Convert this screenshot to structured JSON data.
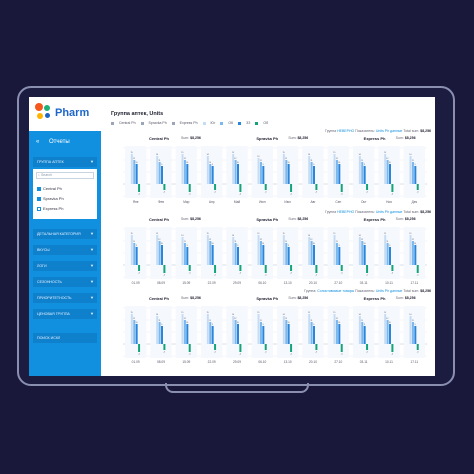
{
  "app": {
    "logo_text": "Pharm",
    "logo_colors": [
      "#f4581e",
      "#1fb07a",
      "#ffb400",
      "#1c66c8"
    ]
  },
  "sidebar": {
    "reports_label": "Отчеты",
    "pharmacy_group_label": "ГРУППА АПТЕК",
    "search_placeholder": "Search",
    "options": [
      {
        "label": "Central Ph",
        "checked": true
      },
      {
        "label": "Spravka Ph",
        "checked": true
      },
      {
        "label": "Express Ph",
        "checked": false
      }
    ],
    "items": [
      {
        "label": "ДЕТАЛЬНАЯ КАТЕГОРИЯ"
      },
      {
        "label": "ВКУСЫ"
      },
      {
        "label": "ЛОГИ"
      },
      {
        "label": "СЕЗОННОСТЬ"
      },
      {
        "label": "ПРИОРИТЕТНОСТЬ"
      },
      {
        "label": "ЦЕНОВАЯ ГРУППА"
      },
      {
        "label": "ПОИСК ИСКЛ"
      }
    ]
  },
  "main": {
    "title": "Группа аптек, Units",
    "legend": [
      {
        "label": "Central Ph",
        "color": "#9aa6b8"
      },
      {
        "label": "Spravka Ph",
        "color": "#9aa6b8"
      },
      {
        "label": "Express Ph",
        "color": "#9aa6b8"
      },
      {
        "label": "Юг",
        "color": "#c6dcf5"
      },
      {
        "label": "ОК",
        "color": "#7ab8ee"
      },
      {
        "label": "ЗЗ",
        "color": "#2a86dc"
      },
      {
        "label": "Об",
        "color": "#14a37a"
      }
    ],
    "panels": [
      {
        "top_line": {
          "group_label": "Группа",
          "group_value": "НЕВЕРНО",
          "pokaz_label": "Показатель:",
          "pokaz_value": "Units Ph данные",
          "total_label": "Total sum:",
          "total_value": "$8,256"
        },
        "groups": [
          {
            "name": "Central Ph",
            "sum_label": "Sum:",
            "sum_value": "$8,256"
          },
          {
            "name": "Spravka Ph",
            "sum_label": "Sum:",
            "sum_value": "$8,256"
          },
          {
            "name": "Express Ph",
            "sum_label": "Sum:",
            "sum_value": "$8,256"
          }
        ],
        "x_labels": [
          "Яне",
          "Фев",
          "Мар",
          "Апр",
          "Май",
          "Июн",
          "Июл",
          "Авг",
          "Сен",
          "Окт",
          "Ноя",
          "Дек"
        ]
      },
      {
        "top_line": {
          "group_label": "Группа",
          "group_value": "НЕВЕРНО",
          "pokaz_label": "Показатель:",
          "pokaz_value": "Units Ph данные",
          "total_label": "Total sum:",
          "total_value": "$8,256"
        },
        "groups": [
          {
            "name": "Central Ph",
            "sum_label": "Sum:",
            "sum_value": "$8,256"
          },
          {
            "name": "Spravka Ph",
            "sum_label": "Sum:",
            "sum_value": "$8,256"
          },
          {
            "name": "Express Ph",
            "sum_label": "Sum:",
            "sum_value": "$8,256"
          }
        ],
        "x_labels": [
          "01.09",
          "08.09",
          "15.09",
          "22.09",
          "29.09",
          "06.10",
          "13.10",
          "20.10",
          "27.10",
          "03.11",
          "10.11",
          "17.11"
        ]
      },
      {
        "top_line": {
          "group_label": "Группа:",
          "group_value": "Сопоставимые товары",
          "pokaz_label": "Показатель:",
          "pokaz_value": "Units Ph данные",
          "total_label": "Total sum:",
          "total_value": "$8,256"
        },
        "groups": [
          {
            "name": "Central Ph",
            "sum_label": "Sum:",
            "sum_value": "$8,256"
          },
          {
            "name": "Spravka Ph",
            "sum_label": "Sum:",
            "sum_value": "$8,256"
          },
          {
            "name": "Express Ph",
            "sum_label": "Sum:",
            "sum_value": "$8,256"
          }
        ],
        "x_labels": [
          "01.09",
          "08.09",
          "15.09",
          "22.09",
          "29.09",
          "06.10",
          "13.10",
          "20.10",
          "27.10",
          "03.11",
          "10.11",
          "17.11"
        ]
      }
    ]
  },
  "chart_data": [
    {
      "type": "bar",
      "title": "",
      "categories": [
        "Яне",
        "Фев",
        "Мар",
        "Апр",
        "Май",
        "Июн",
        "Июл",
        "Авг",
        "Сен",
        "Окт",
        "Ноя",
        "Дек"
      ],
      "series": [
        {
          "name": "Юг",
          "color": "#c6dcf5",
          "values": [
            15,
            14,
            15,
            14,
            15,
            13,
            15,
            14,
            15,
            14,
            15,
            14
          ]
        },
        {
          "name": "ОК",
          "color": "#7ab8ee",
          "values": [
            12,
            11,
            12,
            10,
            12,
            11,
            12,
            11,
            12,
            11,
            12,
            11
          ]
        },
        {
          "name": "ЗЗ",
          "color": "#2a86dc",
          "values": [
            10,
            9,
            10,
            9,
            10,
            9,
            10,
            9,
            10,
            9,
            10,
            9
          ]
        },
        {
          "name": "Об",
          "color": "#14a37a",
          "values": [
            -4,
            -3,
            -4,
            -3,
            -4,
            -3,
            -4,
            -3,
            -4,
            -3,
            -4,
            -3
          ]
        }
      ],
      "ylim": [
        -6,
        18
      ]
    },
    {
      "type": "bar",
      "title": "",
      "categories": [
        "01.09",
        "08.09",
        "15.09",
        "22.09",
        "29.09",
        "06.10",
        "13.10",
        "20.10",
        "27.10",
        "03.11",
        "10.11",
        "17.11"
      ],
      "series": [
        {
          "name": "Юг",
          "color": "#c6dcf5",
          "values": [
            15,
            15,
            14,
            15,
            14,
            15,
            15,
            14,
            15,
            14,
            15,
            15
          ]
        },
        {
          "name": "ОК",
          "color": "#7ab8ee",
          "values": [
            11,
            12,
            11,
            12,
            11,
            12,
            11,
            12,
            11,
            12,
            11,
            12
          ]
        },
        {
          "name": "ЗЗ",
          "color": "#2a86dc",
          "values": [
            9,
            10,
            9,
            10,
            9,
            10,
            9,
            10,
            9,
            10,
            9,
            10
          ]
        },
        {
          "name": "Об",
          "color": "#14a37a",
          "values": [
            -3,
            -4,
            -3,
            -4,
            -3,
            -4,
            -3,
            -4,
            -3,
            -4,
            -3,
            -4
          ]
        }
      ],
      "ylim": [
        -6,
        18
      ]
    },
    {
      "type": "bar",
      "title": "",
      "categories": [
        "01.09",
        "08.09",
        "15.09",
        "22.09",
        "29.09",
        "06.10",
        "13.10",
        "20.10",
        "27.10",
        "03.11",
        "10.11",
        "17.11"
      ],
      "series": [
        {
          "name": "Юг",
          "color": "#c6dcf5",
          "values": [
            15,
            14,
            15,
            15,
            14,
            15,
            14,
            15,
            15,
            14,
            15,
            14
          ]
        },
        {
          "name": "ОК",
          "color": "#7ab8ee",
          "values": [
            12,
            11,
            12,
            11,
            12,
            11,
            12,
            11,
            12,
            11,
            12,
            11
          ]
        },
        {
          "name": "ЗЗ",
          "color": "#2a86dc",
          "values": [
            10,
            9,
            10,
            9,
            10,
            9,
            10,
            9,
            10,
            9,
            10,
            9
          ]
        },
        {
          "name": "Об",
          "color": "#14a37a",
          "values": [
            -4,
            -3,
            -4,
            -3,
            -4,
            -3,
            -4,
            -3,
            -4,
            -3,
            -4,
            -3
          ]
        }
      ],
      "ylim": [
        -6,
        18
      ]
    }
  ]
}
